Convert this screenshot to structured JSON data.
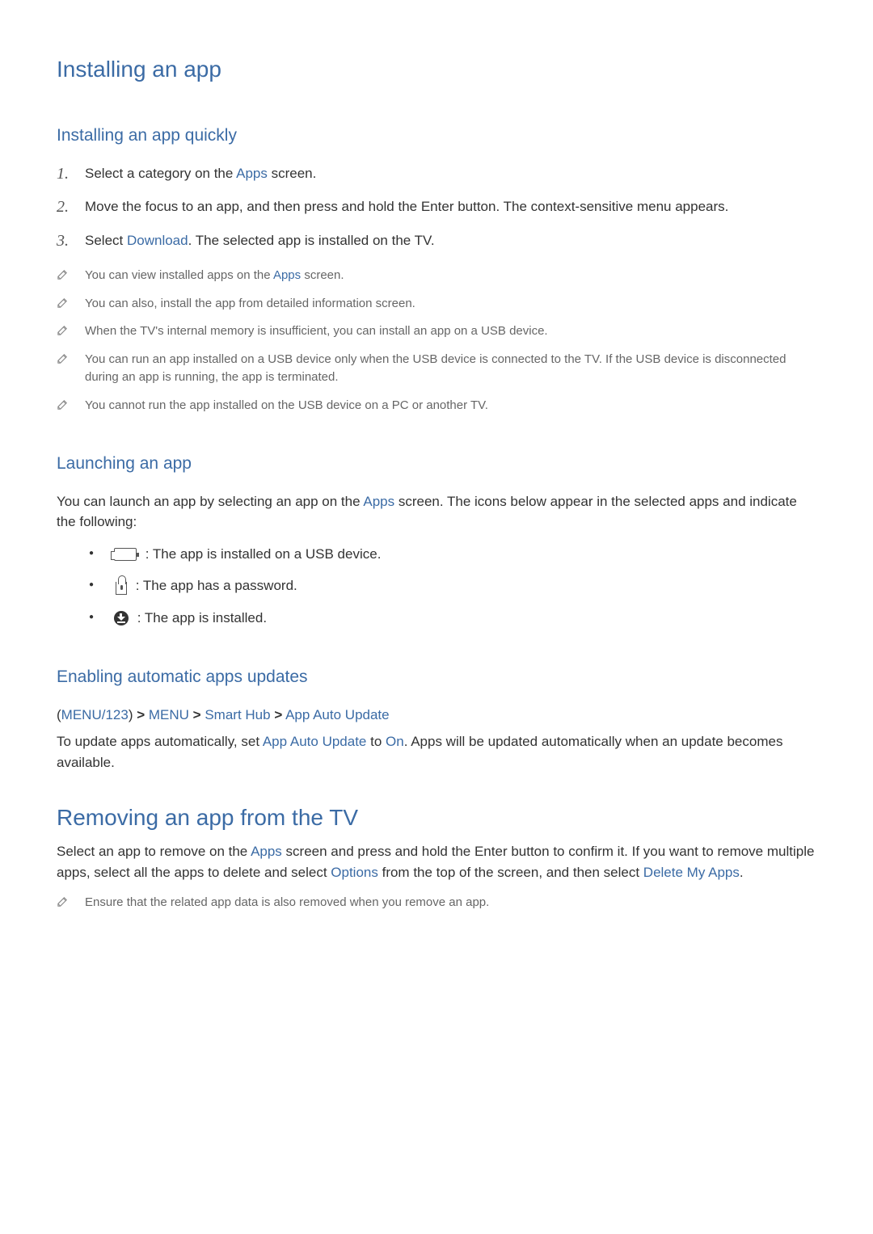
{
  "h1_1": "Installing an app",
  "h2_1": "Installing an app quickly",
  "steps": {
    "s1_pre": "Select a category on the ",
    "s1_blue": "Apps",
    "s1_post": " screen.",
    "s2": "Move the focus to an app, and then press and hold the Enter button. The context-sensitive menu appears.",
    "s3_pre": "Select ",
    "s3_blue": "Download",
    "s3_post": ". The selected app is installed on the TV."
  },
  "notes": {
    "n1_pre": "You can view installed apps on the ",
    "n1_blue": "Apps",
    "n1_post": " screen.",
    "n2": "You can also, install the app from detailed information screen.",
    "n3": "When the TV's internal memory is insufficient, you can install an app on a USB device.",
    "n4": "You can run an app installed on a USB device only when the USB device is connected to the TV. If the USB device is disconnected during an app is running, the app is terminated.",
    "n5": "You cannot run the app installed on the USB device on a PC or another TV."
  },
  "h2_2": "Launching an app",
  "launch_para_pre": "You can launch an app by selecting an app on the ",
  "launch_para_blue": "Apps",
  "launch_para_post": " screen. The icons below appear in the selected apps and indicate the following:",
  "icons": {
    "usb": " : The app is installed on a USB device.",
    "lock": " : The app has a password.",
    "installed": " : The app is installed."
  },
  "h2_3": "Enabling automatic apps updates",
  "path": {
    "p1": "MENU/123",
    "p2": "MENU",
    "p3": "Smart Hub",
    "p4": "App Auto Update"
  },
  "auto_para_pre": "To update apps automatically, set ",
  "auto_para_blue1": "App Auto Update",
  "auto_para_mid": " to ",
  "auto_para_blue2": "On",
  "auto_para_post": ". Apps will be updated automatically when an update becomes available.",
  "h1_2": "Removing an app from the TV",
  "remove_para_pre": "Select an app to remove on the ",
  "remove_blue1": "Apps",
  "remove_mid1": " screen and press and hold the Enter button to confirm it. If you want to remove multiple apps, select all the apps to delete and select ",
  "remove_blue2": "Options",
  "remove_mid2": " from the top of the screen, and then select ",
  "remove_blue3": "Delete My Apps",
  "remove_post": ".",
  "remove_note": "Ensure that the related app data is also removed when you remove an app."
}
